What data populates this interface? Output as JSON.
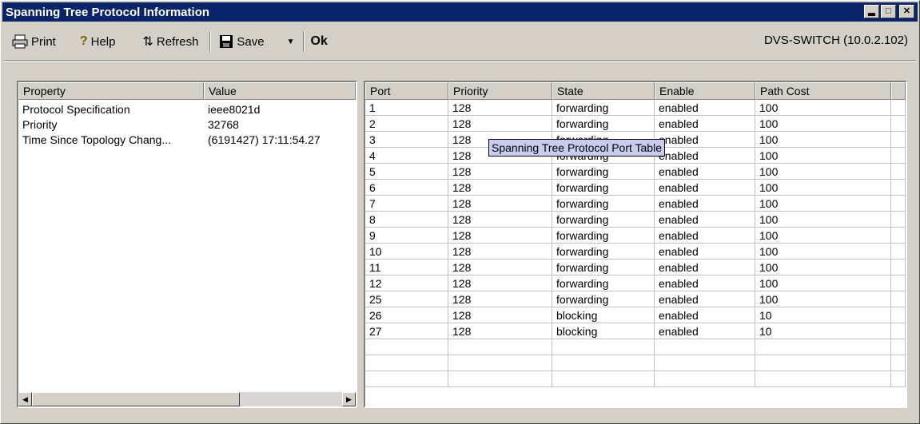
{
  "window": {
    "title": "Spanning Tree Protocol Information"
  },
  "toolbar": {
    "print_label": "Print",
    "help_label": "Help",
    "refresh_label": "Refresh",
    "save_label": "Save",
    "ok_label": "Ok",
    "device_label": "DVS-SWITCH (10.0.2.102)"
  },
  "properties": {
    "headers": {
      "property": "Property",
      "value": "Value"
    },
    "rows": [
      {
        "property": "Protocol Specification",
        "value": "ieee8021d"
      },
      {
        "property": "Priority",
        "value": "32768"
      },
      {
        "property": "Time Since Topology Chang...",
        "value": "(6191427) 17:11:54.27"
      }
    ]
  },
  "port_table": {
    "headers": {
      "port": "Port",
      "priority": "Priority",
      "state": "State",
      "enable": "Enable",
      "path_cost": "Path Cost"
    },
    "rows": [
      {
        "port": "1",
        "priority": "128",
        "state": "forwarding",
        "enable": "enabled",
        "path_cost": "100"
      },
      {
        "port": "2",
        "priority": "128",
        "state": "forwarding",
        "enable": "enabled",
        "path_cost": "100"
      },
      {
        "port": "3",
        "priority": "128",
        "state": "forwarding",
        "enable": "enabled",
        "path_cost": "100"
      },
      {
        "port": "4",
        "priority": "128",
        "state": "forwarding",
        "enable": "enabled",
        "path_cost": "100"
      },
      {
        "port": "5",
        "priority": "128",
        "state": "forwarding",
        "enable": "enabled",
        "path_cost": "100"
      },
      {
        "port": "6",
        "priority": "128",
        "state": "forwarding",
        "enable": "enabled",
        "path_cost": "100"
      },
      {
        "port": "7",
        "priority": "128",
        "state": "forwarding",
        "enable": "enabled",
        "path_cost": "100"
      },
      {
        "port": "8",
        "priority": "128",
        "state": "forwarding",
        "enable": "enabled",
        "path_cost": "100"
      },
      {
        "port": "9",
        "priority": "128",
        "state": "forwarding",
        "enable": "enabled",
        "path_cost": "100"
      },
      {
        "port": "10",
        "priority": "128",
        "state": "forwarding",
        "enable": "enabled",
        "path_cost": "100"
      },
      {
        "port": "11",
        "priority": "128",
        "state": "forwarding",
        "enable": "enabled",
        "path_cost": "100"
      },
      {
        "port": "12",
        "priority": "128",
        "state": "forwarding",
        "enable": "enabled",
        "path_cost": "100"
      },
      {
        "port": "25",
        "priority": "128",
        "state": "forwarding",
        "enable": "enabled",
        "path_cost": "100"
      },
      {
        "port": "26",
        "priority": "128",
        "state": "blocking",
        "enable": "enabled",
        "path_cost": "10"
      },
      {
        "port": "27",
        "priority": "128",
        "state": "blocking",
        "enable": "enabled",
        "path_cost": "10"
      }
    ],
    "tooltip": "Spanning Tree Protocol Port Table"
  },
  "icons": {
    "print": "printer-icon",
    "help": "help-icon",
    "refresh": "refresh-icon",
    "save": "floppy-disk-icon",
    "minimize": "minimize-icon",
    "maximize": "maximize-icon",
    "close": "close-icon"
  }
}
